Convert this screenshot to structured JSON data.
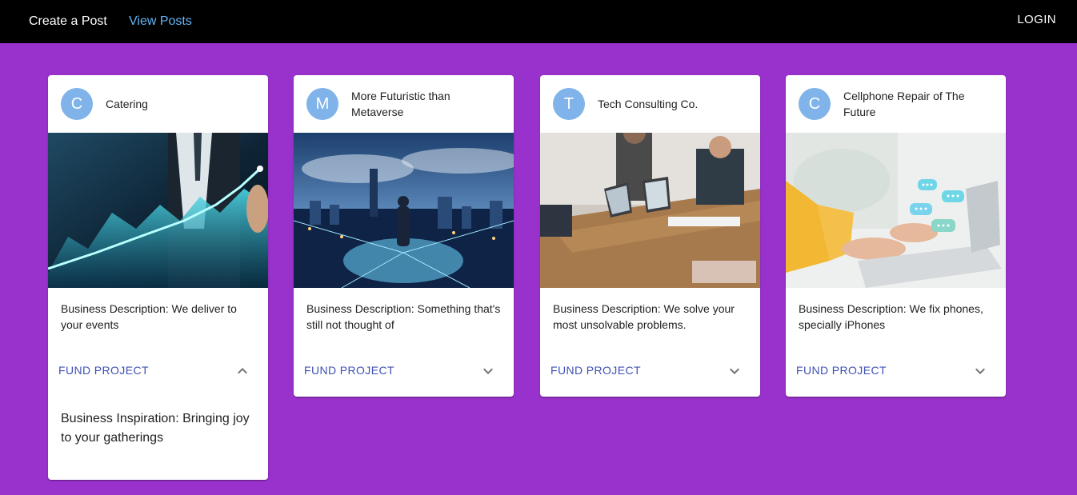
{
  "nav": {
    "create_label": "Create a Post",
    "view_label": "View Posts",
    "login_label": "LOGIN"
  },
  "colors": {
    "background": "#9932cc",
    "navbar": "#000000",
    "active_link": "#64b5f6",
    "avatar": "#7fb3ea",
    "button": "#3f51b5"
  },
  "posts": [
    {
      "avatar": "C",
      "title": "Catering",
      "image": "business-growth-chart",
      "description": "Business Description: We deliver to your events",
      "fund_label": "FUND PROJECT",
      "expanded": true,
      "expand_icon": "chevron-up-icon",
      "inspiration": "Business Inspiration: Bringing joy to your gatherings"
    },
    {
      "avatar": "M",
      "title": "More Futuristic than Metaverse",
      "image": "futuristic-city-man",
      "description": "Business Description: Something that's still not thought of",
      "fund_label": "FUND PROJECT",
      "expanded": false,
      "expand_icon": "chevron-down-icon"
    },
    {
      "avatar": "T",
      "title": "Tech Consulting Co.",
      "image": "office-meeting-laptops",
      "description": "Business Description: We solve your most unsolvable problems.",
      "fund_label": "FUND PROJECT",
      "expanded": false,
      "expand_icon": "chevron-down-icon"
    },
    {
      "avatar": "C",
      "title": "Cellphone Repair of The Future",
      "image": "laptop-chat-bubbles",
      "description": "Business Description: We fix phones, specially iPhones",
      "fund_label": "FUND PROJECT",
      "expanded": false,
      "expand_icon": "chevron-down-icon"
    }
  ]
}
